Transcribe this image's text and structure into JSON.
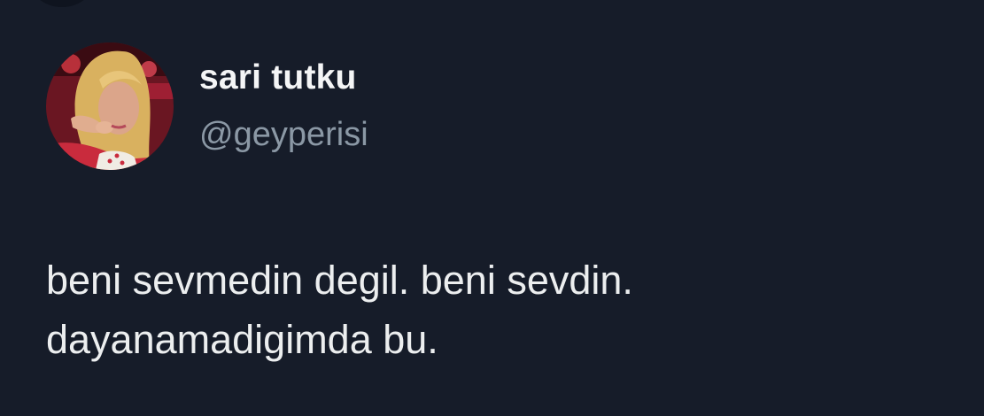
{
  "tweet": {
    "author": {
      "display_name": "sari tutku",
      "handle": "@geyperisi",
      "avatar": "profile-photo"
    },
    "text_lines": [
      "beni sevmedin degil. beni sevdin.",
      "dayanamadigimda bu."
    ]
  },
  "colors": {
    "background": "#161c29",
    "primary_text": "#eceeef",
    "secondary_text": "#8b98a5"
  }
}
